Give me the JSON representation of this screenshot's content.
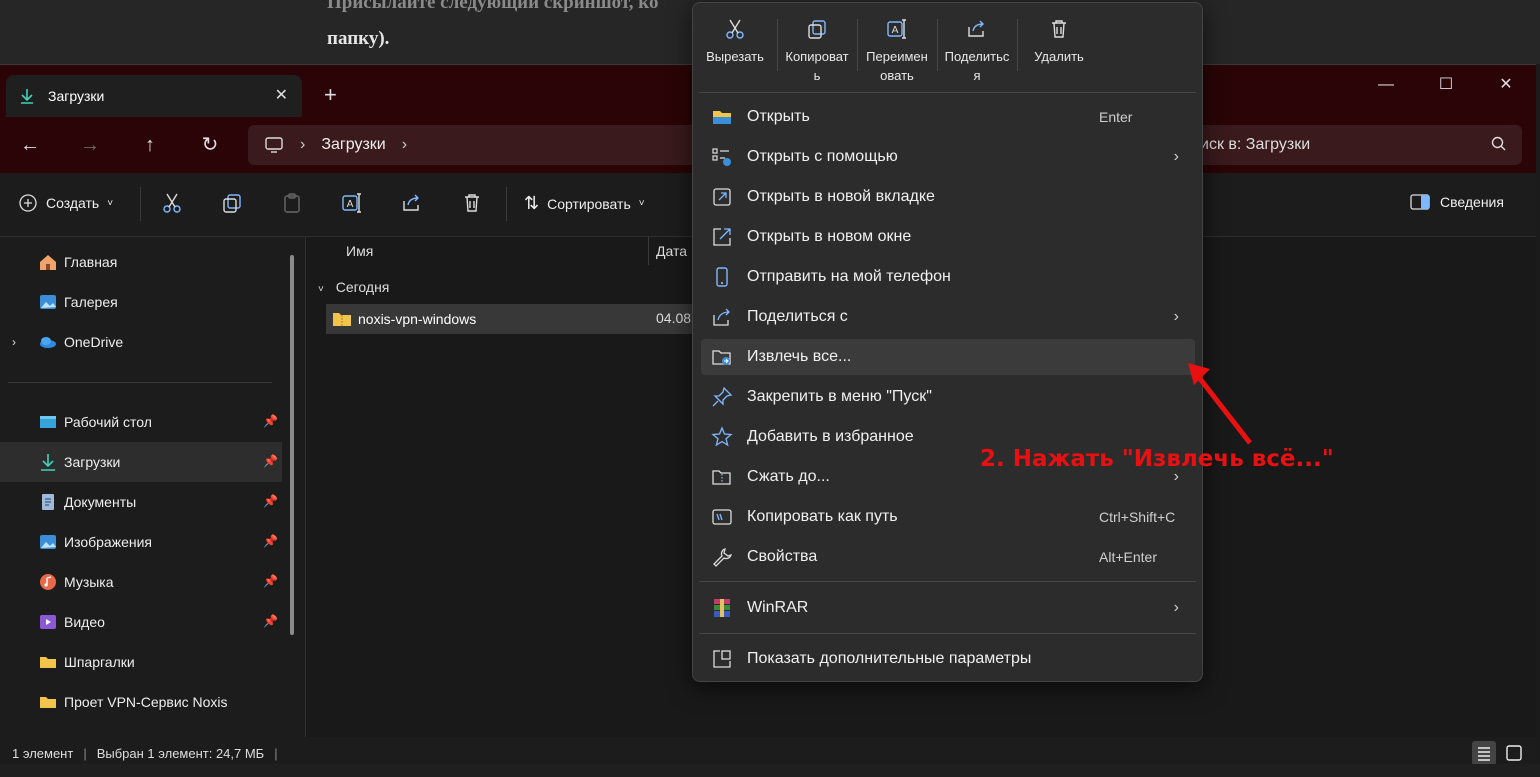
{
  "background_page": {
    "line1": "Присылайте следующий скриншот, ко",
    "line2": "папку)."
  },
  "tab": {
    "title": "Загрузки"
  },
  "address": {
    "segment": "Загрузки"
  },
  "search": {
    "placeholder": "иск в: Загрузки"
  },
  "toolbar": {
    "create_label": "Создать",
    "sort_label": "Сортировать",
    "details_label": "Сведения"
  },
  "sidebar": {
    "items": [
      {
        "label": "Главная"
      },
      {
        "label": "Галерея"
      },
      {
        "label": "OneDrive"
      },
      {
        "label": "Рабочий стол"
      },
      {
        "label": "Загрузки"
      },
      {
        "label": "Документы"
      },
      {
        "label": "Изображения"
      },
      {
        "label": "Музыка"
      },
      {
        "label": "Видео"
      },
      {
        "label": "Шпаргалки"
      },
      {
        "label": "Проет VPN-Сервис Noxis"
      }
    ]
  },
  "content": {
    "col_name": "Имя",
    "col_date": "Дата",
    "group": "Сегодня",
    "file_name": "noxis-vpn-windows",
    "file_date": "04.08."
  },
  "status": {
    "count": "1 элемент",
    "selected": "Выбран 1 элемент: 24,7 МБ"
  },
  "context_menu": {
    "quick_actions": [
      {
        "line1": "Вырезать",
        "line2": ""
      },
      {
        "line1": "Копироват",
        "line2": "ь"
      },
      {
        "line1": "Переимен",
        "line2": "овать"
      },
      {
        "line1": "Поделитьс",
        "line2": "я"
      },
      {
        "line1": "Удалить",
        "line2": ""
      }
    ],
    "items": [
      {
        "label": "Открыть",
        "shortcut": "Enter"
      },
      {
        "label": "Открыть с помощью",
        "arrow": "›"
      },
      {
        "label": "Открыть в новой вкладке"
      },
      {
        "label": "Открыть в новом окне"
      },
      {
        "label": "Отправить на мой телефон"
      },
      {
        "label": "Поделиться с",
        "arrow": "›"
      },
      {
        "label": "Извлечь все..."
      },
      {
        "label": "Закрепить в меню \"Пуск\""
      },
      {
        "label": "Добавить в избранное"
      },
      {
        "label": "Сжать до...",
        "arrow": "›"
      },
      {
        "label": "Копировать как путь",
        "shortcut": "Ctrl+Shift+C"
      },
      {
        "label": "Свойства",
        "shortcut": "Alt+Enter"
      },
      {
        "label": "WinRAR",
        "arrow": "›"
      },
      {
        "label": "Показать дополнительные параметры"
      }
    ]
  },
  "annotation": {
    "text": "2. Нажать \"Извлечь всё...\"",
    "color": "#e81010"
  }
}
